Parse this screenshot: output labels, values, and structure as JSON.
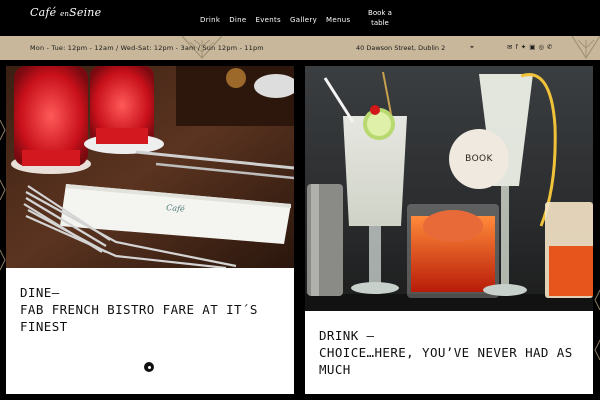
{
  "header": {
    "logo_main": "Café",
    "logo_small": "en",
    "logo_tail": "Seine",
    "nav": [
      "Drink",
      "Dine",
      "Events",
      "Gallery",
      "Menus"
    ],
    "book_table": "Book a table"
  },
  "infobar": {
    "hours": "Mon - Tue: 12pm - 12am / Wed-Sat: 12pm - 3am / Sun 12pm - 11pm",
    "address": "40 Dawson Street, Dublin 2",
    "icons": [
      "map-pin-icon",
      "mail-icon",
      "facebook-icon",
      "twitter-icon",
      "instagram-icon",
      "tripadvisor-icon",
      "phone-icon"
    ]
  },
  "dine": {
    "title_line1": "DINE—",
    "title_line2": "FAB FRENCH BISTRO FARE AT IT´S FINEST"
  },
  "drink": {
    "title_line1": "DRINK —",
    "title_line2": "CHOICE…HERE, YOU’VE NEVER HAD AS MUCH",
    "book_button": "BOOK"
  },
  "colors": {
    "background": "#000000",
    "infobar": "#c8b79a",
    "card": "#ffffff",
    "book_circle": "#efe9df"
  }
}
